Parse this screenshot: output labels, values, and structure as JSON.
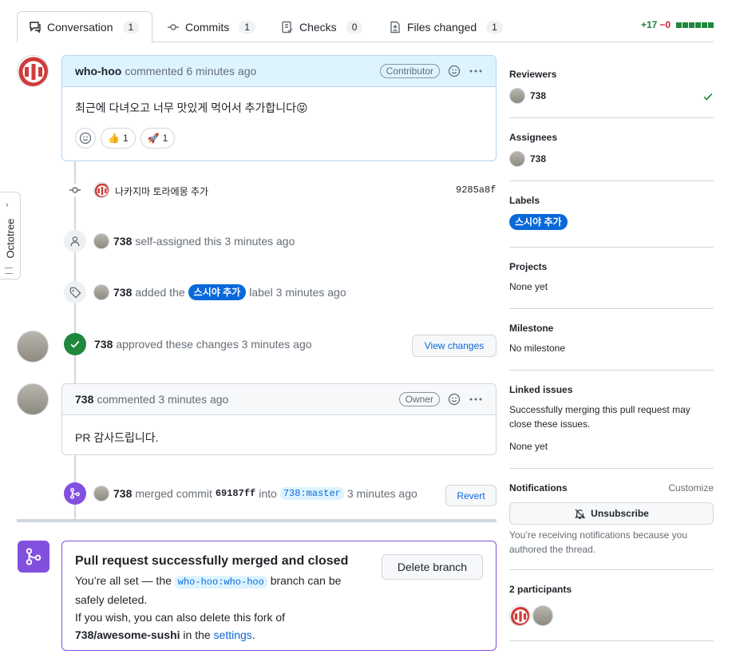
{
  "tabs": [
    {
      "label": "Conversation",
      "count": "1"
    },
    {
      "label": "Commits",
      "count": "1"
    },
    {
      "label": "Checks",
      "count": "0"
    },
    {
      "label": "Files changed",
      "count": "1"
    }
  ],
  "diffstat": {
    "additions": "+17",
    "deletions": "−0"
  },
  "octotree": "Octotree",
  "comment1": {
    "author": "who-hoo",
    "action": "commented 6 minutes ago",
    "role": "Contributor",
    "body": "최근에 다녀오고 너무 맛있게 먹어서 추가합니다😝",
    "reactions": [
      {
        "emoji": "👍",
        "count": "1"
      },
      {
        "emoji": "🚀",
        "count": "1"
      }
    ]
  },
  "commit": {
    "message": "나카지마 토라에몽 추가",
    "sha": "9285a8f"
  },
  "events": {
    "self_assigned": {
      "user": "738",
      "text": "self-assigned this 3 minutes ago"
    },
    "labeled": {
      "user": "738",
      "before": "added the",
      "label": "스시야 추가",
      "after": "label 3 minutes ago"
    },
    "approved": {
      "user": "738",
      "text": "approved these changes 3 minutes ago",
      "button": "View changes"
    },
    "merged": {
      "user": "738",
      "before": "merged commit",
      "sha": "69187ff",
      "into": "into",
      "branch": "738:master",
      "after": "3 minutes ago",
      "button": "Revert"
    }
  },
  "comment2": {
    "author": "738",
    "action": "commented 3 minutes ago",
    "role": "Owner",
    "body": "PR 감사드립니다."
  },
  "merge_box": {
    "title": "Pull request successfully merged and closed",
    "line1_before": "You’re all set — the",
    "branch": "who-hoo:who-hoo",
    "line1_after": "branch can be",
    "line2": "safely deleted.",
    "line3": "If you wish, you can also delete this fork of",
    "repo": "738/awesome-sushi",
    "line4_mid": "in the",
    "settings_link": "settings",
    "line4_end": ".",
    "button": "Delete branch"
  },
  "sidebar": {
    "reviewers": {
      "title": "Reviewers",
      "user": "738"
    },
    "assignees": {
      "title": "Assignees",
      "user": "738"
    },
    "labels": {
      "title": "Labels",
      "label": "스시야 추가"
    },
    "projects": {
      "title": "Projects",
      "value": "None yet"
    },
    "milestone": {
      "title": "Milestone",
      "value": "No milestone"
    },
    "linked": {
      "title": "Linked issues",
      "desc": "Successfully merging this pull request may close these issues.",
      "value": "None yet"
    },
    "notifications": {
      "title": "Notifications",
      "customize": "Customize",
      "button": "Unsubscribe",
      "desc": "You’re receiving notifications because you authored the thread."
    },
    "participants": {
      "title": "2 participants"
    }
  },
  "colors": {
    "accent": "#0969da",
    "success": "#1f883d",
    "merged": "#8250df"
  }
}
